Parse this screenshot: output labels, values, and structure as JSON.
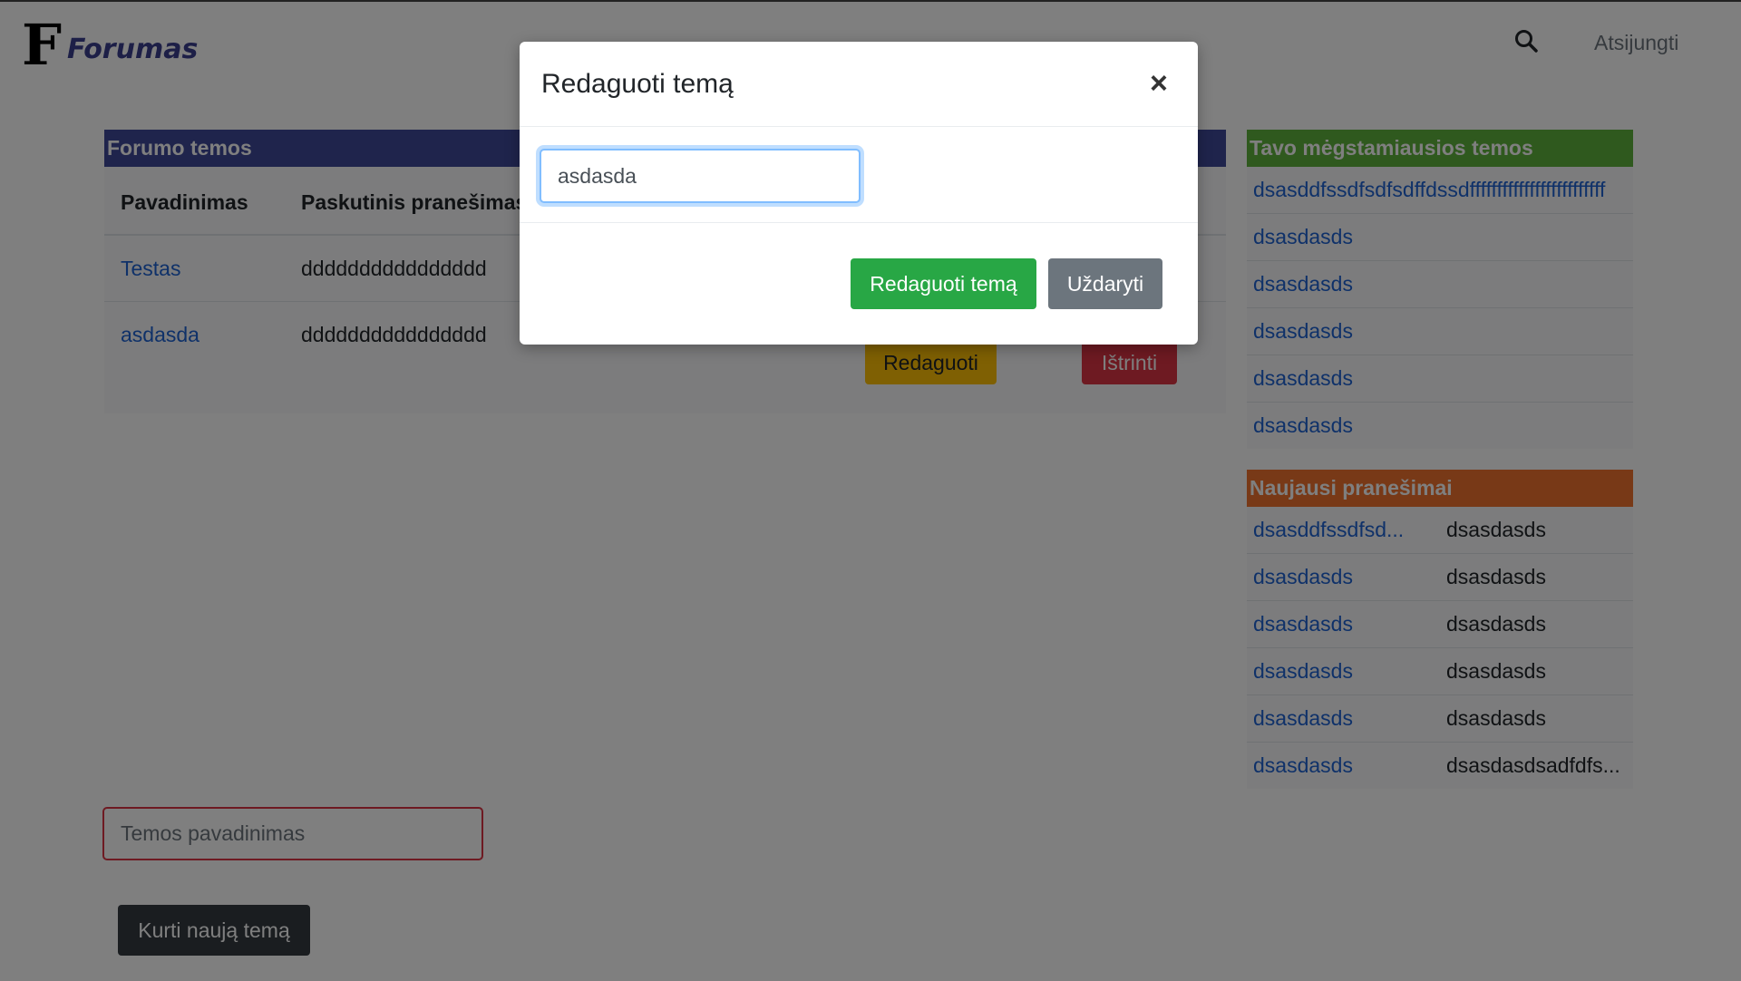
{
  "header": {
    "logo_letter": "F",
    "logo_text": "Forumas",
    "logout": "Atsijungti"
  },
  "topics": {
    "title": "Forumo temos",
    "columns": [
      "Pavadinimas",
      "Paskutinis pranešimas"
    ],
    "rows": [
      {
        "name": "Testas",
        "last": "dddddddddddddddd"
      },
      {
        "name": "asdasda",
        "last": "dddddddddddddddd"
      }
    ],
    "edit_label": "Redaguoti",
    "delete_label": "Ištrinti"
  },
  "favorites": {
    "title": "Tavo mėgstamiausios temos",
    "items": [
      "dsasddfssdfsdfsdffdssdfffffffffffffffffffffffff",
      "dsasdasds",
      "dsasdasds",
      "dsasdasds",
      "dsasdasds",
      "dsasdasds"
    ]
  },
  "latest": {
    "title": "Naujausi pranešimai",
    "items": [
      {
        "topic": "dsasddfssdfsd...",
        "text": "dsasdasds"
      },
      {
        "topic": "dsasdasds",
        "text": "dsasdasds"
      },
      {
        "topic": "dsasdasds",
        "text": "dsasdasds"
      },
      {
        "topic": "dsasdasds",
        "text": "dsasdasds"
      },
      {
        "topic": "dsasdasds",
        "text": "dsasdasds"
      },
      {
        "topic": "dsasdasds",
        "text": "dsasdasdsadfdfs..."
      }
    ]
  },
  "new_topic": {
    "placeholder": "Temos pavadinimas",
    "button": "Kurti naują temą"
  },
  "modal": {
    "title": "Redaguoti temą",
    "close_symbol": "×",
    "input_value": "asdasda",
    "save_label": "Redaguoti temą",
    "close_label": "Uždaryti"
  },
  "colors": {
    "topics_header": "#3f4898",
    "favorites_header": "#5fb33c",
    "latest_header": "#f0722f",
    "link": "#1f63d3"
  }
}
